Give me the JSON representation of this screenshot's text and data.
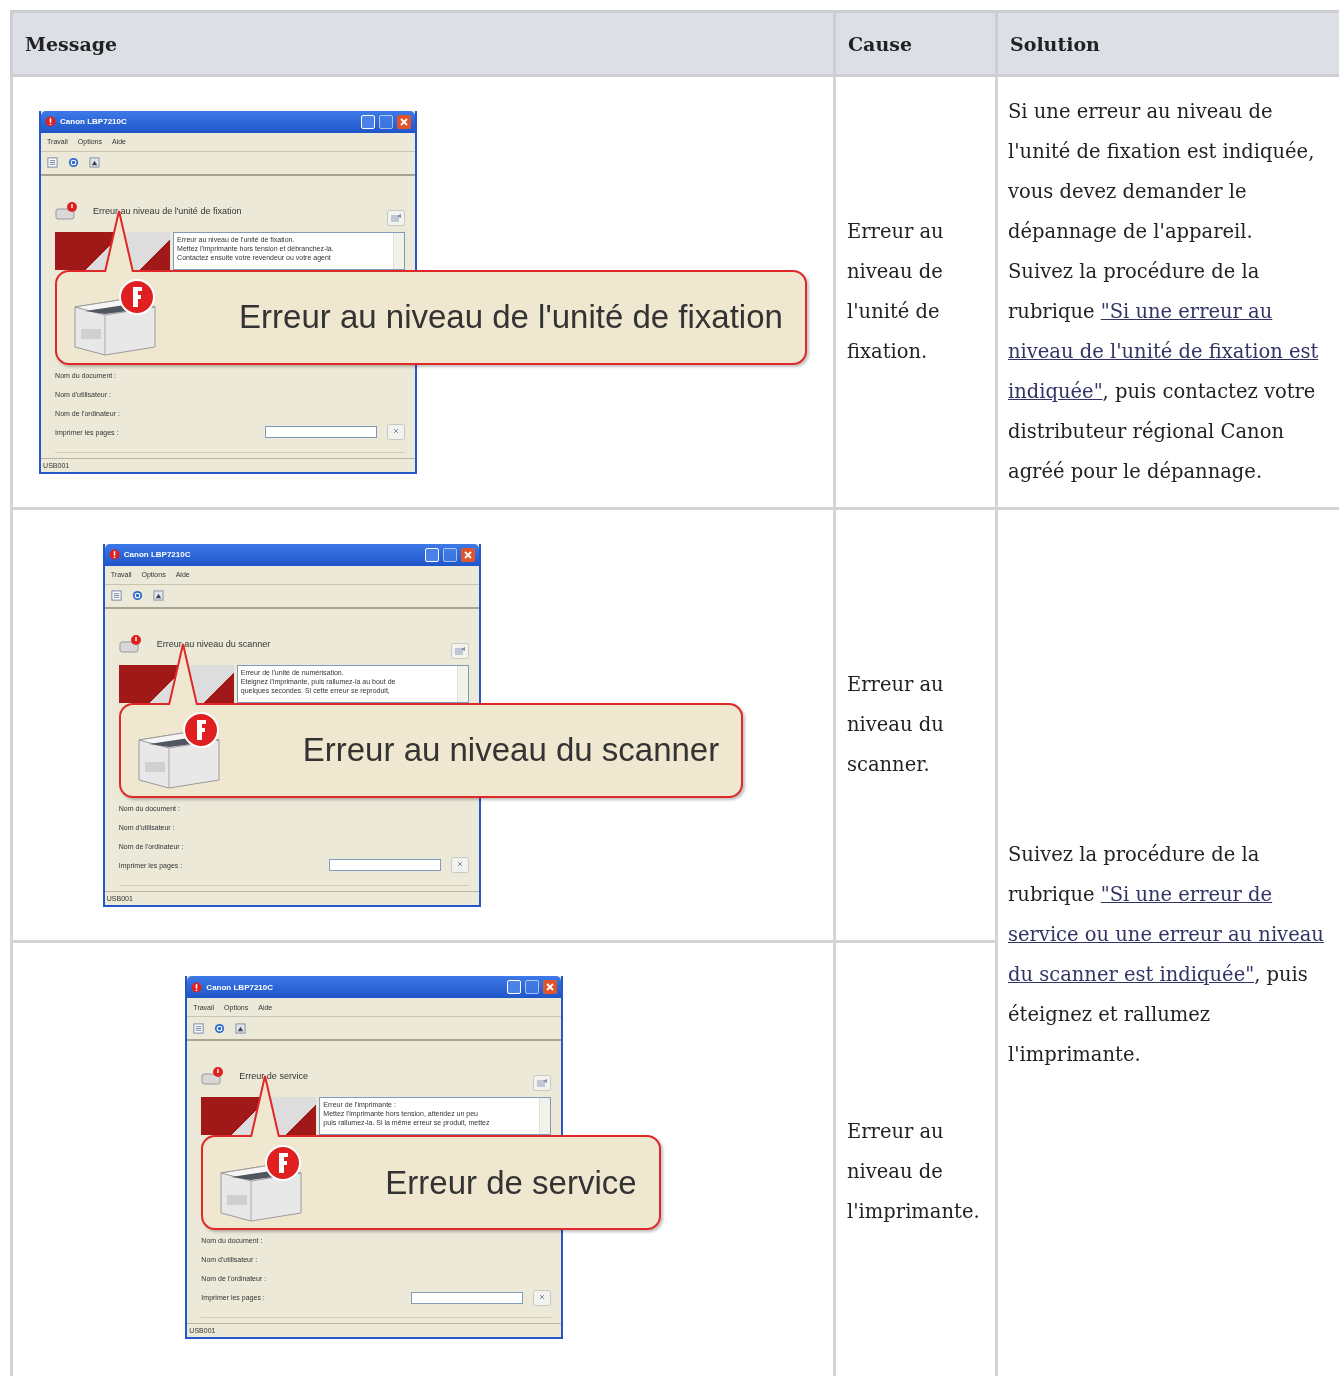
{
  "table": {
    "columns": [
      "Message",
      "Cause",
      "Solution"
    ],
    "rows": [
      {
        "message": {
          "title": "Canon LBP7210C",
          "menu": [
            "Travail",
            "Options",
            "Aide"
          ],
          "status_message": "Erreur au niveau de l'unité de fixation",
          "details": [
            "Erreur au niveau de l'unité de fixation.",
            "Mettez l'imprimante hors tension et débranchez-la.",
            "Contactez ensuite votre revendeur ou votre agent"
          ],
          "fields": [
            "Nom du document :",
            "Nom d'utilisateur :",
            "Nom de l'ordinateur :",
            "Imprimer les pages :"
          ],
          "status_bar": "USB001",
          "callout": "Erreur au niveau de l'unité de fixation"
        },
        "cause": "Erreur au niveau de l'unité de fixation.",
        "solution": [
          [
            {
              "kind": "text",
              "text": "Si une erreur au niveau de l'unité de fixation est indiquée, vous devez demander le dépannage de l'appareil."
            }
          ],
          [
            {
              "kind": "text",
              "text": "Suivez la procédure de la rubrique "
            },
            {
              "kind": "link",
              "text": "\"Si une erreur au"
            },
            {
              "kind": "link",
              "text": "niveau de l'unité de fixation est"
            },
            {
              "kind": "link",
              "text": "indiquée\""
            },
            {
              "kind": "text",
              "text": ", puis contactez votre distributeur régional Canon agréé pour le dépannage."
            }
          ]
        ]
      },
      {
        "message": {
          "title": "Canon LBP7210C",
          "menu": [
            "Travail",
            "Options",
            "Aide"
          ],
          "status_message": "Erreur au niveau du scanner",
          "details": [
            "Erreur de l'unité de numérisation.",
            "Eteignez l'imprimante, puis rallumez-la au bout de",
            "quelques secondes. Si cette erreur se reproduit,"
          ],
          "fields": [
            "Nom du document :",
            "Nom d'utilisateur :",
            "Nom de l'ordinateur :",
            "Imprimer les pages :"
          ],
          "status_bar": "USB001",
          "callout": "Erreur au niveau du scanner"
        },
        "cause": "Erreur au niveau du scanner.",
        "solution": [
          [
            {
              "kind": "text",
              "text": "Suivez la procédure de la rubrique "
            },
            {
              "kind": "link",
              "text": "\"Si une erreur de"
            },
            {
              "kind": "link",
              "text": "service ou une erreur au niveau"
            },
            {
              "kind": "link",
              "text": "du scanner est indiquée\""
            },
            {
              "kind": "text",
              "text": ", puis éteignez et rallumez l'imprimante."
            }
          ]
        ]
      },
      {
        "message": {
          "title": "Canon LBP7210C",
          "menu": [
            "Travail",
            "Options",
            "Aide"
          ],
          "status_message": "Erreur de service",
          "details": [
            "Erreur de l'imprimante :",
            "Mettez l'imprimante hors tension, attendez un peu",
            "puis rallumez-la. Si la même erreur se produit, mettez"
          ],
          "fields": [
            "Nom du document :",
            "Nom d'utilisateur :",
            "Nom de l'ordinateur :",
            "Imprimer les pages :"
          ],
          "status_bar": "USB001",
          "callout": "Erreur de service"
        },
        "cause": "Erreur au niveau de l'imprimante."
      }
    ]
  }
}
